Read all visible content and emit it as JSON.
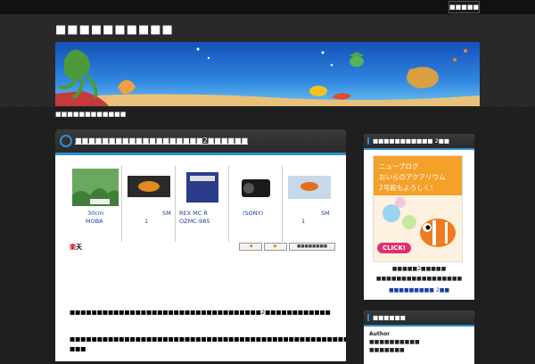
{
  "top_bar": {
    "button_label": "■■■■■"
  },
  "header": {
    "site_title": "■■■■■■■■■■",
    "tagline": "■■■■■■■■■■■■"
  },
  "main": {
    "post_title": "■■■■■■■■■■■■■■■■■■■2■■■■■■",
    "products": [
      {
        "name": "30cm",
        "sub": "MOBA"
      },
      {
        "name": "SM",
        "sub": "1"
      },
      {
        "name": "REX MC R",
        "sub": "OZMC-985"
      },
      {
        "name": "(SONY)",
        "sub": ""
      },
      {
        "name": "SM",
        "sub": "1"
      }
    ],
    "rakuten_logo": "楽",
    "rakuten_logo_rest": "天",
    "prev_label": "◀",
    "next_label": "▶",
    "about_label": "■■■■■■■■",
    "para1": "■■■■■■■■■■■■■■■■■■■■■■■■■■■■■■■■■■■2■■■■■■■■■■■■",
    "para2": "■■■■■■■■■■■■■■■■■■■■■■■■■■■■■■■■■■■■■■■■■■■■■■■■■■■■■■■■■■■■■■■■■■■■■■■■■■■■■■",
    "para2b": "■■■"
  },
  "sidebar": {
    "widget1_title": "■■■■■■■■■■■ 2■■",
    "ad_lines": [
      "ニューブログ",
      "おいらのアクアリウム",
      "2号館もよろしく！"
    ],
    "ad_click": "CLICK!",
    "ad_caption1": "■■■■■2■■■■■",
    "ad_caption2": "■■■■■■■■■■■■■■■■■",
    "ad_link": "■■■■■■■■■ 2■■",
    "widget2_title": "■■■■■■",
    "author_label": "Author",
    "author_line1": "■■■■■■■■■■",
    "author_line2": "■■■■■■■"
  },
  "colors": {
    "accent": "#2a8fd0",
    "background": "#1f1f1f"
  }
}
